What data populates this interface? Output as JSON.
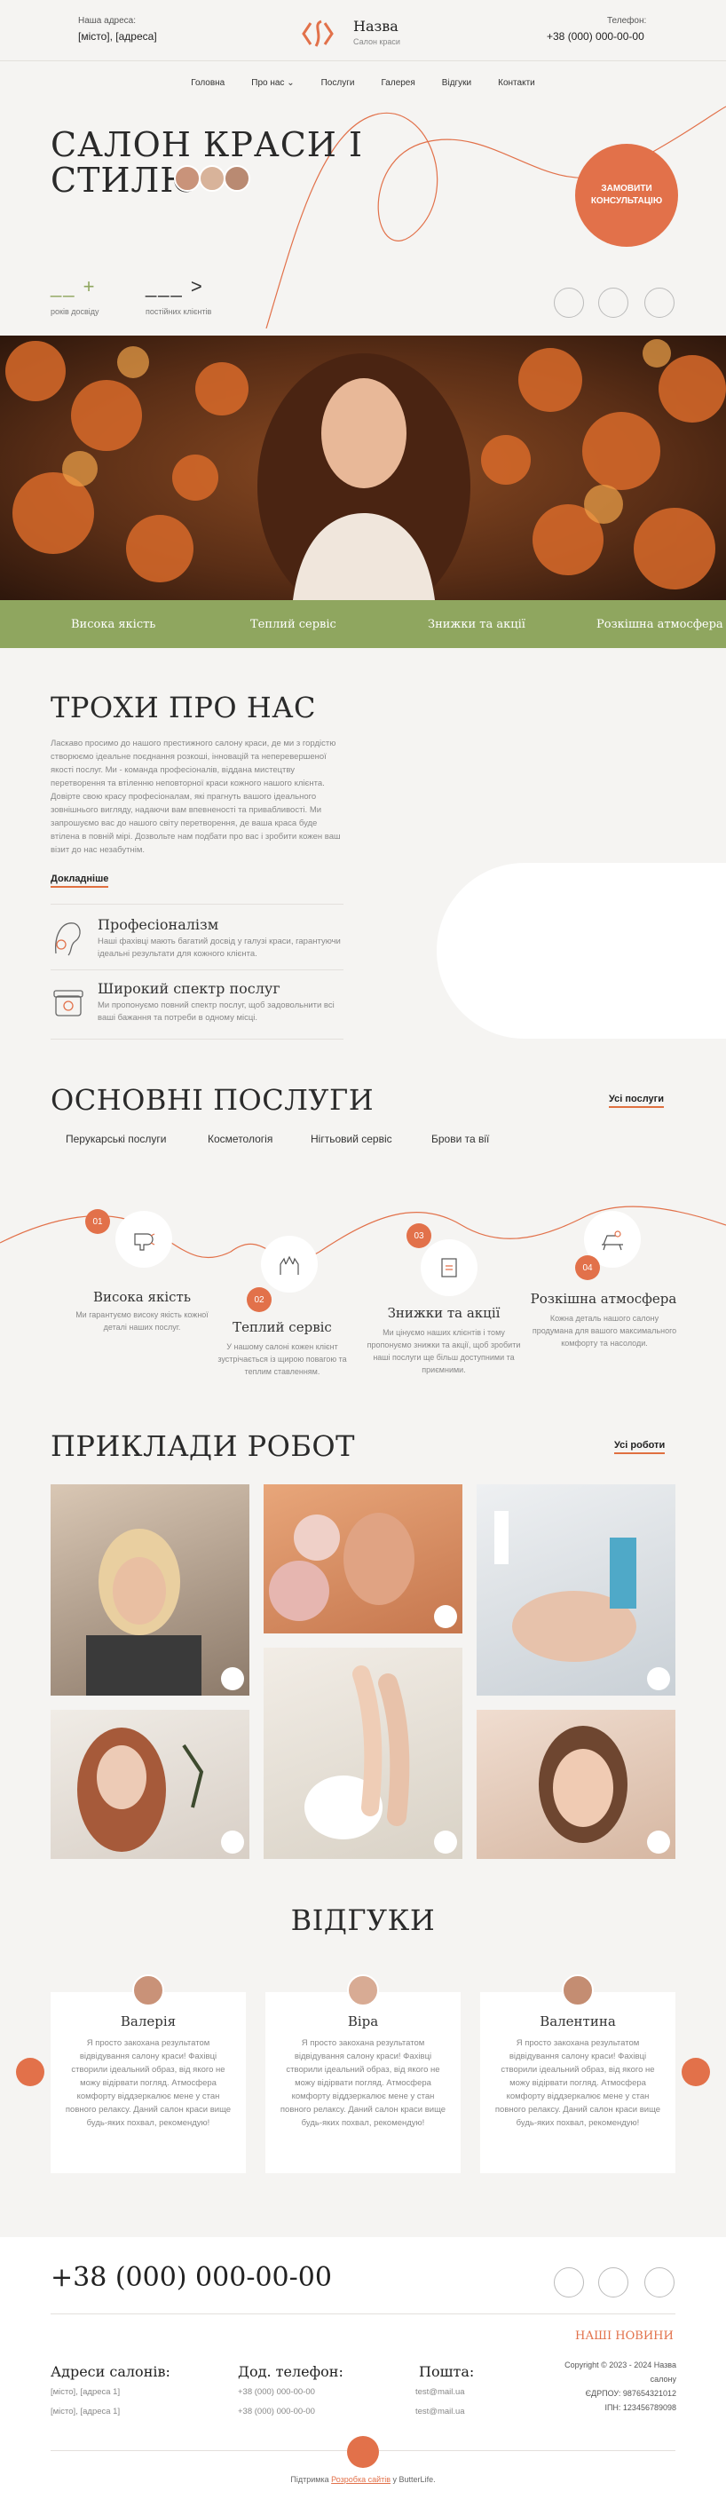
{
  "header": {
    "address_label": "Наша адреса:",
    "address_value": "[місто], [адреса]",
    "brand_name": "Назва",
    "brand_sub": "Салон краси",
    "phone_label": "Телефон:",
    "phone_value": "+38 (000) 000-00-00"
  },
  "nav": {
    "items": [
      "Головна",
      "Про нас",
      "Послуги",
      "Галерея",
      "Відгуки",
      "Контакти"
    ]
  },
  "hero": {
    "title_line1": "САЛОН КРАСИ І",
    "title_line2": "СТИЛЮ",
    "order_button": "ЗАМОВИТИ\nКОНСУЛЬТАЦІЮ",
    "stat1_value": "__ +",
    "stat1_label": "років досвіду",
    "stat2_value": "___ >",
    "stat2_label": "постійних клієнтів"
  },
  "features_bar": [
    "Висока якість",
    "Теплий сервіс",
    "Знижки та акції",
    "Розкішна атмосфера"
  ],
  "about": {
    "title": "ТРОХИ ПРО НАС",
    "text": "Ласкаво просимо до нашого престижного салону краси, де ми з гордістю створюємо ідеальне поєднання розкоші, інновацій та неперевершеної якості послуг. Ми - команда професіоналів, віддана мистецтву перетворення та втіленню неповторної краси кожного нашого клієнта. Довірте свою красу професіоналам, які прагнуть вашого ідеального зовнішнього вигляду, надаючи вам впевненості та привабливості. Ми запрошуємо вас до нашого світу перетворення, де ваша краса буде втілена в повній мірі. Дозвольте нам подбати про вас і зробити кожен ваш візит до нас незабутнім.",
    "more_link": "Докладніше",
    "f1_title": "Професіоналізм",
    "f1_text": "Наші фахівці мають багатий досвід у галузі краси, гарантуючи ідеальні результати для кожного клієнта.",
    "f2_title": "Широкий спектр послуг",
    "f2_text": "Ми пропонуємо повний спектр послуг, щоб задовольнити всі ваші бажання та потреби в одному місці."
  },
  "services": {
    "title": "ОСНОВНІ ПОСЛУГИ",
    "all_link": "Усі послуги",
    "tabs": [
      "Перукарські послуги",
      "Косметологія",
      "Нігтьовий сервіс",
      "Брови та вії"
    ],
    "items": [
      {
        "num": "01",
        "title": "Висока якість",
        "text": "Ми гарантуємо високу якість кожної деталі наших послуг."
      },
      {
        "num": "02",
        "title": "Теплий сервіс",
        "text": "У нашому салоні кожен клієнт зустрічається із щирою повагою та теплим ставленням."
      },
      {
        "num": "03",
        "title": "Знижки та акції",
        "text": "Ми цінуємо наших клієнтів і тому пропонуємо знижки та акції, щоб зробити наші послуги ще більш доступними та приємними."
      },
      {
        "num": "04",
        "title": "Розкішна атмосфера",
        "text": "Кожна деталь нашого салону продумана для вашого максимального комфорту та насолоди."
      }
    ]
  },
  "works": {
    "title": "ПРИКЛАДИ РОБОТ",
    "all_link": "Усі роботи"
  },
  "reviews": {
    "title": "ВІДГУКИ",
    "items": [
      {
        "name": "Валерія",
        "text": "Я просто закохана результатом відвідування салону краси! Фахівці створили ідеальний образ, від якого не можу відірвати погляд. Атмосфера комфорту віддзеркалює мене у стан повного релаксу. Даний салон краси вище будь-яких похвал, рекомендую!"
      },
      {
        "name": "Віра",
        "text": "Я просто закохана результатом відвідування салону краси! Фахівці створили ідеальний образ, від якого не можу відірвати погляд. Атмосфера комфорту віддзеркалює мене у стан повного релаксу. Даний салон краси вище будь-яких похвал, рекомендую!"
      },
      {
        "name": "Валентина",
        "text": "Я просто закохана результатом відвідування салону краси! Фахівці створили ідеальний образ, від якого не можу відірвати погляд. Атмосфера комфорту віддзеркалює мене у стан повного релаксу. Даний салон краси вище будь-яких похвал, рекомендую!"
      }
    ]
  },
  "footer": {
    "phone": "+38 (000) 000-00-00",
    "news_link": "НАШІ НОВИНИ",
    "addr_title": "Адреси салонів:",
    "addr1": "[місто], [адреса 1]",
    "addr2": "[місто], [адреса 1]",
    "tel_title": "Дод. телефон:",
    "tel1": "+38 (000) 000-00-00",
    "tel2": "+38 (000) 000-00-00",
    "mail_title": "Пошта:",
    "mail1": "test@mail.ua",
    "mail2": "test@mail.ua",
    "copyright": "Copyright © 2023 - 2024 Назва салону",
    "edrpou": "ЄДРПОУ: 987654321012",
    "ipn": "ІПН: 123456789098",
    "support_prefix": "Підтримка",
    "support_link": "Розробка сайтів",
    "support_suffix": "у ButterLife."
  },
  "colors": {
    "accent": "#e2714a",
    "green": "#8fa65f",
    "bg": "#f5f4f2"
  }
}
